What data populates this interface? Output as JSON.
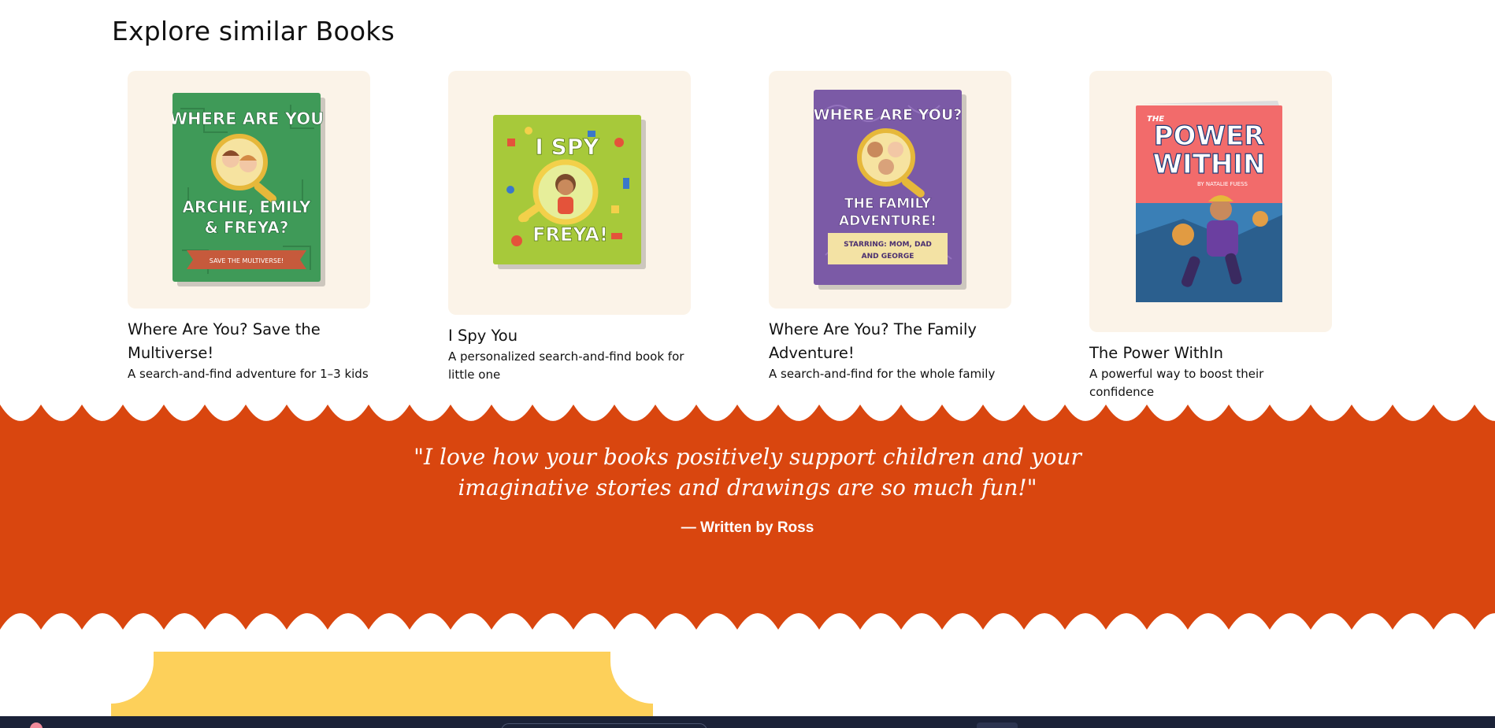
{
  "section_title": "Explore similar Books",
  "books": [
    {
      "title": "Where Are You? Save the Multiverse!",
      "description": "A search-and-find adventure for 1–3 kids",
      "cover": {
        "line1": "WHERE ARE YOU",
        "line2": "ARCHIE, EMILY",
        "line3": "& FREYA?",
        "ribbon": "SAVE THE MULTIVERSE!",
        "color": "#3f9a58"
      }
    },
    {
      "title": "I Spy You",
      "description": "A personalized search-and-find book for little one",
      "cover": {
        "line1": "I SPY",
        "line2": "FREYA!",
        "color": "#a7c93a"
      }
    },
    {
      "title": "Where Are You? The Family Adventure!",
      "description": "A search-and-find for the whole family",
      "cover": {
        "line1": "WHERE ARE YOU?",
        "line2": "THE FAMILY",
        "line3": "ADVENTURE!",
        "ribbon1": "STARRING: MOM, DAD",
        "ribbon2": "AND GEORGE",
        "color": "#7b5aa6"
      }
    },
    {
      "title": "The Power WithIn",
      "description": "A powerful way to boost their confidence",
      "cover": {
        "line0": "THE",
        "line1": "POWER",
        "line2": "WITHIN",
        "byline": "BY NATALIE FUESS",
        "color": "#f26b6b"
      }
    }
  ],
  "testimonial": {
    "quote": "\"I love how your books positively support children and your imaginative stories and drawings are so much fun!\"",
    "author": "— Written by Ross"
  },
  "colors": {
    "band": "#d9460f",
    "card_bg": "#fbf3e8",
    "ticket": "#fdd05a"
  }
}
